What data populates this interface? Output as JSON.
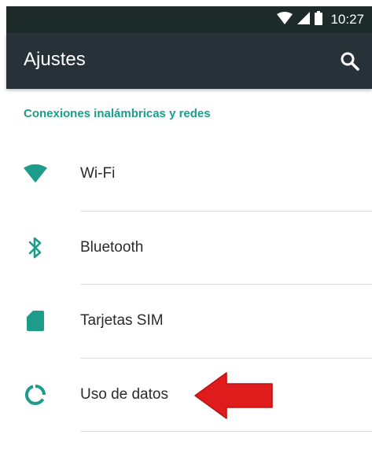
{
  "status_bar": {
    "time": "10:27",
    "icons": [
      "wifi-icon",
      "signal-icon",
      "battery-icon"
    ],
    "background": "#1c2b29"
  },
  "app_bar": {
    "title": "Ajustes",
    "search_icon": "search-icon",
    "background": "#263238"
  },
  "section": {
    "header": "Conexiones inalámbricas y redes",
    "accent_color": "#1e9c8a"
  },
  "items": [
    {
      "label": "Wi-Fi",
      "icon": "wifi-icon"
    },
    {
      "label": "Bluetooth",
      "icon": "bluetooth-icon"
    },
    {
      "label": "Tarjetas SIM",
      "icon": "sim-card-icon"
    },
    {
      "label": "Uso de datos",
      "icon": "data-usage-icon"
    }
  ],
  "annotation": {
    "icon": "red-arrow",
    "color": "#e01b1b"
  }
}
